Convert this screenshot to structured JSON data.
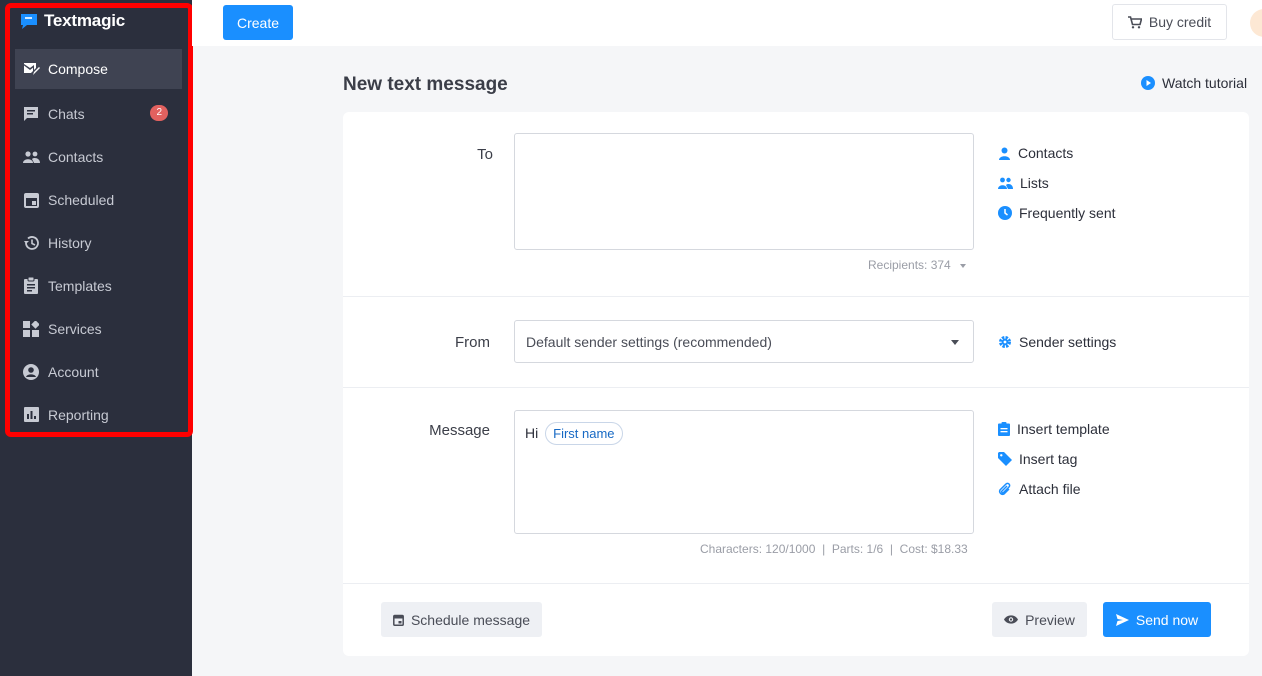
{
  "app": {
    "name": "Textmagic"
  },
  "sidebar": {
    "items": [
      {
        "label": "Compose",
        "icon": "compose-icon",
        "active": true
      },
      {
        "label": "Chats",
        "icon": "chat-icon",
        "badge": "2"
      },
      {
        "label": "Contacts",
        "icon": "contacts-icon"
      },
      {
        "label": "Scheduled",
        "icon": "calendar-icon"
      },
      {
        "label": "History",
        "icon": "history-icon"
      },
      {
        "label": "Templates",
        "icon": "clipboard-icon"
      },
      {
        "label": "Services",
        "icon": "services-grid-icon"
      },
      {
        "label": "Account",
        "icon": "account-icon"
      },
      {
        "label": "Reporting",
        "icon": "bar-chart-icon"
      }
    ],
    "highlight_color": "#ff0000"
  },
  "topbar": {
    "create_label": "Create",
    "buy_credit_label": "Buy credit"
  },
  "page": {
    "title": "New text message",
    "watch_tutorial": "Watch tutorial"
  },
  "form": {
    "to_label": "To",
    "recipients": "Recipients: 374",
    "to_links": [
      "Contacts",
      "Lists",
      "Frequently sent"
    ],
    "from_label": "From",
    "from_value": "Default sender settings (recommended)",
    "sender_settings": "Sender settings",
    "message_label": "Message",
    "message_text": "Hi",
    "message_tag": "First name",
    "message_links": [
      "Insert template",
      "Insert tag",
      "Attach file"
    ],
    "stats": "Characters: 120/1000  |  Parts: 1/6  |  Cost: $18.33"
  },
  "actions": {
    "schedule_label": "Schedule message",
    "preview_label": "Preview",
    "send_label": "Send now"
  },
  "colors": {
    "accent": "#1a8fff",
    "sidebar_bg": "#2b2f3d",
    "badge": "#e2615f"
  }
}
